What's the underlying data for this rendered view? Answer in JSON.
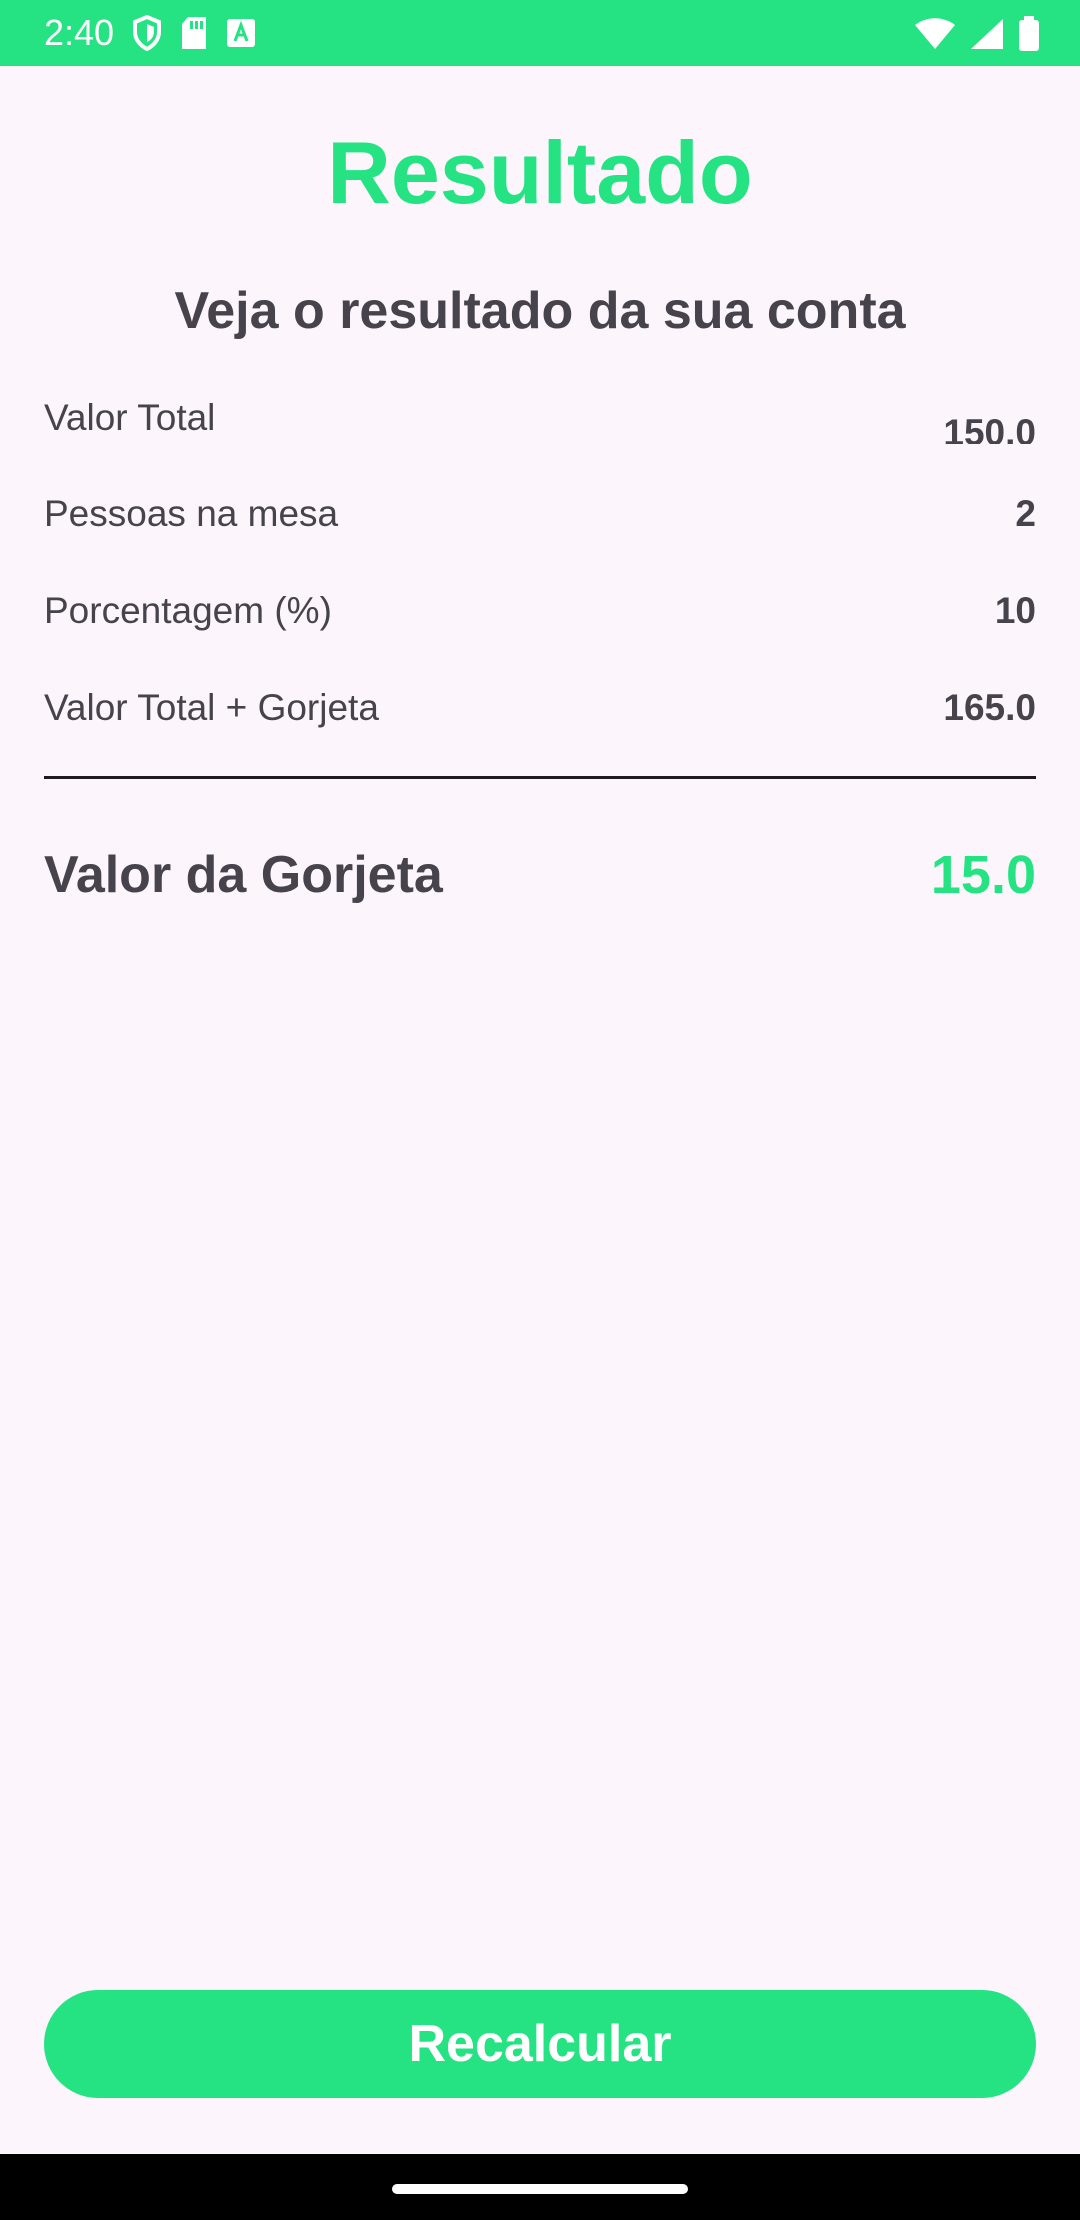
{
  "status_bar": {
    "time": "2:40",
    "left_icons": [
      "shield-icon",
      "sd-card-icon",
      "font-a-icon"
    ],
    "right_icons": [
      "wifi-icon",
      "cell-signal-icon",
      "battery-icon"
    ]
  },
  "header": {
    "title": "Resultado",
    "subtitle": "Veja o resultado da sua conta"
  },
  "summary": {
    "rows": [
      {
        "label": "Valor Total",
        "value": "150.0"
      },
      {
        "label": "Pessoas na mesa",
        "value": "2"
      },
      {
        "label": "Porcentagem (%)",
        "value": "10"
      },
      {
        "label": "Valor Total + Gorjeta",
        "value": "165.0"
      }
    ]
  },
  "tip": {
    "label": "Valor da Gorjeta",
    "value": "15.0"
  },
  "actions": {
    "recalculate_label": "Recalcular"
  },
  "colors": {
    "accent": "#25e382",
    "text": "#46434c",
    "background": "#fcf6fc"
  }
}
